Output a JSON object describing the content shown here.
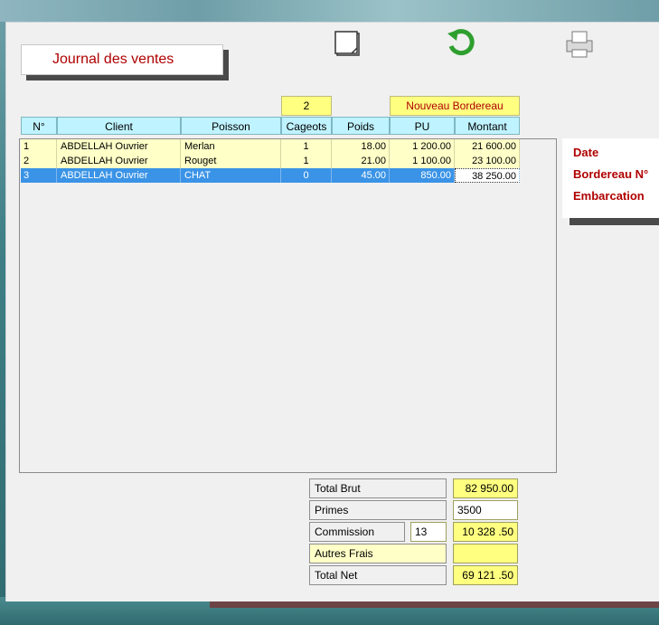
{
  "title": "Journal des ventes",
  "toolbar": {
    "new_icon": "page-icon",
    "refresh_icon": "refresh-icon",
    "print_icon": "print-icon"
  },
  "cageots_count": "2",
  "nouveau_bordereau": "Nouveau Bordereau",
  "columns": [
    "N°",
    "Client",
    "Poisson",
    "Cageots",
    "Poids",
    "PU",
    "Montant"
  ],
  "rows": [
    {
      "n": "1",
      "client": "ABDELLAH  Ouvrier",
      "poisson": "Merlan",
      "cageots": "1",
      "poids": "18.00",
      "pu": "1 200.00",
      "montant": "21 600.00"
    },
    {
      "n": "2",
      "client": "ABDELLAH  Ouvrier",
      "poisson": "Rouget",
      "cageots": "1",
      "poids": "21.00",
      "pu": "1 100.00",
      "montant": "23 100.00"
    },
    {
      "n": "3",
      "client": "ABDELLAH  Ouvrier",
      "poisson": "CHAT",
      "cageots": "0",
      "poids": "45.00",
      "pu": "850.00",
      "montant": "38 250.00"
    }
  ],
  "right_panel": {
    "date": "Date",
    "bordereau": "Bordereau N°",
    "embarcation": "Embarcation"
  },
  "totals": {
    "brut_label": "Total Brut",
    "brut_value": "82 950.00",
    "primes_label": "Primes",
    "primes_value": "3500",
    "commission_label": "Commission",
    "commission_rate": "13",
    "commission_value": "10 328 .50",
    "autres_label": "Autres Frais",
    "autres_value": "",
    "net_label": "Total Net",
    "net_value": "69 121 .50"
  }
}
